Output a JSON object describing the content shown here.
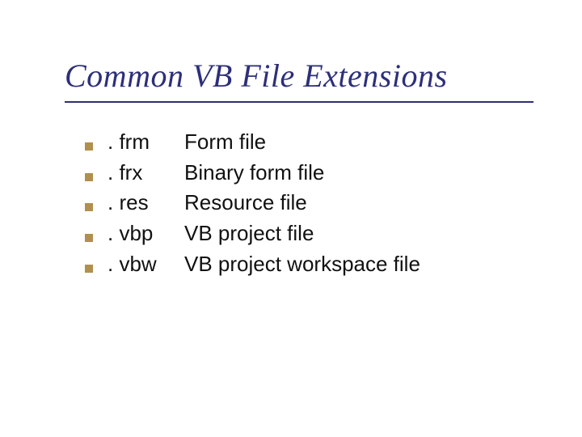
{
  "title": "Common VB File Extensions",
  "items": [
    {
      "ext": ". frm",
      "desc": "Form file"
    },
    {
      "ext": ". frx",
      "desc": "Binary form file"
    },
    {
      "ext": ". res",
      "desc": "Resource file"
    },
    {
      "ext": ". vbp",
      "desc": "VB project file"
    },
    {
      "ext": ". vbw",
      "desc": "VB project workspace file"
    }
  ]
}
